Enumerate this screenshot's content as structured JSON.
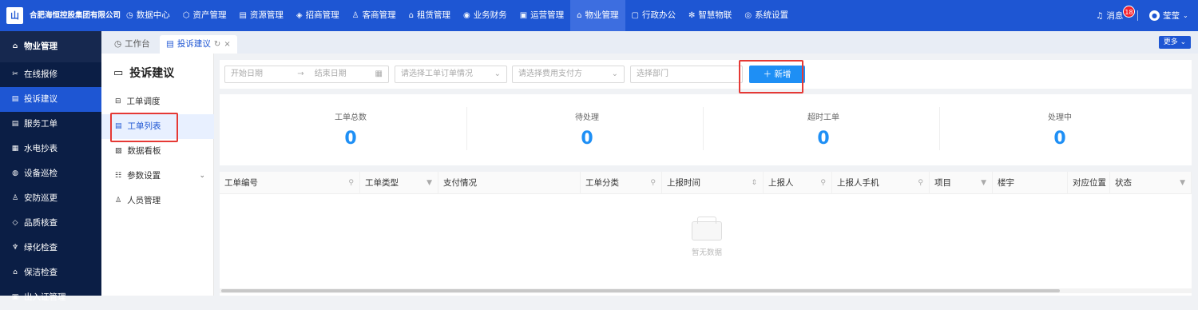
{
  "app": {
    "logo_text": "山",
    "company": "合肥海恒控股集团有限公司"
  },
  "topnav": [
    {
      "label": "数据中心",
      "icon": "dashboard-icon",
      "glyph": "◷"
    },
    {
      "label": "资产管理",
      "icon": "cube-icon",
      "glyph": "⬡"
    },
    {
      "label": "资源管理",
      "icon": "resource-icon",
      "glyph": "▤"
    },
    {
      "label": "招商管理",
      "icon": "tag-icon",
      "glyph": "◈"
    },
    {
      "label": "客商管理",
      "icon": "people-icon",
      "glyph": "♙"
    },
    {
      "label": "租赁管理",
      "icon": "home-icon",
      "glyph": "⌂"
    },
    {
      "label": "业务财务",
      "icon": "finance-icon",
      "glyph": "◉"
    },
    {
      "label": "运营管理",
      "icon": "monitor-icon",
      "glyph": "▣"
    },
    {
      "label": "物业管理",
      "icon": "property-icon",
      "glyph": "⌂"
    },
    {
      "label": "行政办公",
      "icon": "office-icon",
      "glyph": "▢"
    },
    {
      "label": "智慧物联",
      "icon": "iot-icon",
      "glyph": "✻"
    },
    {
      "label": "系统设置",
      "icon": "settings-icon",
      "glyph": "◎"
    }
  ],
  "topnav_active_index": 8,
  "header_right": {
    "message_label": "消息",
    "message_count": "18",
    "user_name": "莹莹"
  },
  "sidebar": {
    "header": "物业管理",
    "items": [
      {
        "label": "在线报修",
        "glyph": "✂"
      },
      {
        "label": "投诉建议",
        "glyph": "▤"
      },
      {
        "label": "服务工单",
        "glyph": "▤"
      },
      {
        "label": "水电抄表",
        "glyph": "▦"
      },
      {
        "label": "设备巡检",
        "glyph": "◍"
      },
      {
        "label": "安防巡更",
        "glyph": "♙"
      },
      {
        "label": "品质核查",
        "glyph": "◇"
      },
      {
        "label": "绿化检查",
        "glyph": "♆"
      },
      {
        "label": "保洁检查",
        "glyph": "⌂"
      },
      {
        "label": "出入证管理",
        "glyph": "▣"
      }
    ],
    "active_index": 1
  },
  "tabs": {
    "home": "工作台",
    "current": "投诉建议",
    "more": "更多"
  },
  "submenu": {
    "title": "投诉建议",
    "items": [
      {
        "label": "工单调度",
        "glyph": "⊟"
      },
      {
        "label": "工单列表",
        "glyph": "▤"
      },
      {
        "label": "数据看板",
        "glyph": "▨"
      },
      {
        "label": "参数设置",
        "glyph": "☷",
        "has_chevron": true
      },
      {
        "label": "人员管理",
        "glyph": "♙"
      }
    ],
    "active_index": 1
  },
  "filters": {
    "start_date": "开始日期",
    "arrow": "→",
    "end_date": "结束日期",
    "order_status": "请选择工单订单情况",
    "payer": "请选择费用支付方",
    "department": "选择部门",
    "add_label": "新增"
  },
  "stats": [
    {
      "label": "工单总数",
      "value": "0"
    },
    {
      "label": "待处理",
      "value": "0"
    },
    {
      "label": "超时工单",
      "value": "0"
    },
    {
      "label": "处理中",
      "value": "0"
    }
  ],
  "table": {
    "columns": [
      {
        "label": "工单编号",
        "filter": "search-icon"
      },
      {
        "label": "工单类型",
        "filter": "filter-icon"
      },
      {
        "label": "支付情况",
        "filter": ""
      },
      {
        "label": "工单分类",
        "filter": "search-icon"
      },
      {
        "label": "上报时间",
        "filter": "sort-icon"
      },
      {
        "label": "上报人",
        "filter": "search-icon"
      },
      {
        "label": "上报人手机",
        "filter": "search-icon"
      },
      {
        "label": "项目",
        "filter": "filter-icon"
      },
      {
        "label": "楼宇",
        "filter": ""
      },
      {
        "label": "对应位置",
        "filter": ""
      },
      {
        "label": "状态",
        "filter": "filter-icon"
      }
    ],
    "empty_text": "暂无数据"
  },
  "colors": {
    "primary": "#1e56d3",
    "sidebar_bg": "#0b1e45",
    "accent_button": "#1e8ff5",
    "highlight_box": "#e53935"
  }
}
